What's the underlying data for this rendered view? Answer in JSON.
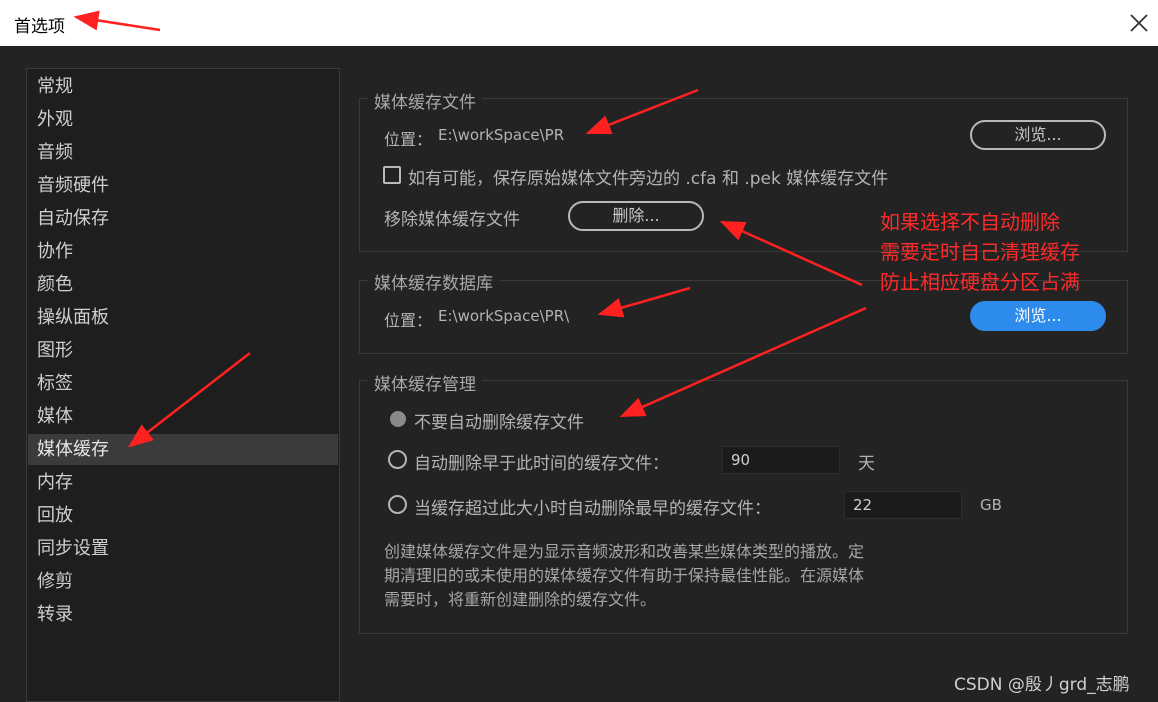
{
  "window": {
    "title": "首选项"
  },
  "sidebar": {
    "items": [
      "常规",
      "外观",
      "音频",
      "音频硬件",
      "自动保存",
      "协作",
      "颜色",
      "操纵面板",
      "图形",
      "标签",
      "媒体",
      "媒体缓存",
      "内存",
      "回放",
      "同步设置",
      "修剪",
      "转录"
    ],
    "selected": "媒体缓存"
  },
  "media_cache_files": {
    "title": "媒体缓存文件",
    "location_label": "位置：",
    "location_value": "E:\\workSpace\\PR",
    "browse_label": "浏览...",
    "checkbox_label": "如有可能，保存原始媒体文件旁边的 .cfa 和 .pek 媒体缓存文件",
    "checkbox_checked": false,
    "remove_label": "移除媒体缓存文件",
    "delete_label": "删除..."
  },
  "media_cache_db": {
    "title": "媒体缓存数据库",
    "location_label": "位置：",
    "location_value": "E:\\workSpace\\PR\\",
    "browse_label": "浏览..."
  },
  "cache_management": {
    "title": "媒体缓存管理",
    "selected_option": 0,
    "option_no_auto": "不要自动删除缓存文件",
    "option_older_label": "自动删除早于此时间的缓存文件：",
    "option_older_value": "90",
    "option_older_unit": "天",
    "option_size_label": "当缓存超过此大小时自动删除最早的缓存文件：",
    "option_size_value": "22",
    "option_size_unit": "GB",
    "description_lines": [
      "创建媒体缓存文件是为显示音频波形和改善某些媒体类型的播放。定",
      "期清理旧的或未使用的媒体缓存文件有助于保持最佳性能。在源媒体",
      "需要时，将重新创建删除的缓存文件。"
    ]
  },
  "annotation": {
    "lines": [
      "如果选择不自动删除",
      "需要定时自己清理缓存",
      "防止相应硬盘分区占满"
    ],
    "color": "#ff2a2a"
  },
  "watermark": "CSDN @殷丿grd_志鹏",
  "colors": {
    "accent": "#2d8ceb",
    "background": "#232323",
    "titlebar": "#ffffff"
  },
  "icons": {
    "close": "close-icon",
    "arrow": "red-arrow"
  }
}
